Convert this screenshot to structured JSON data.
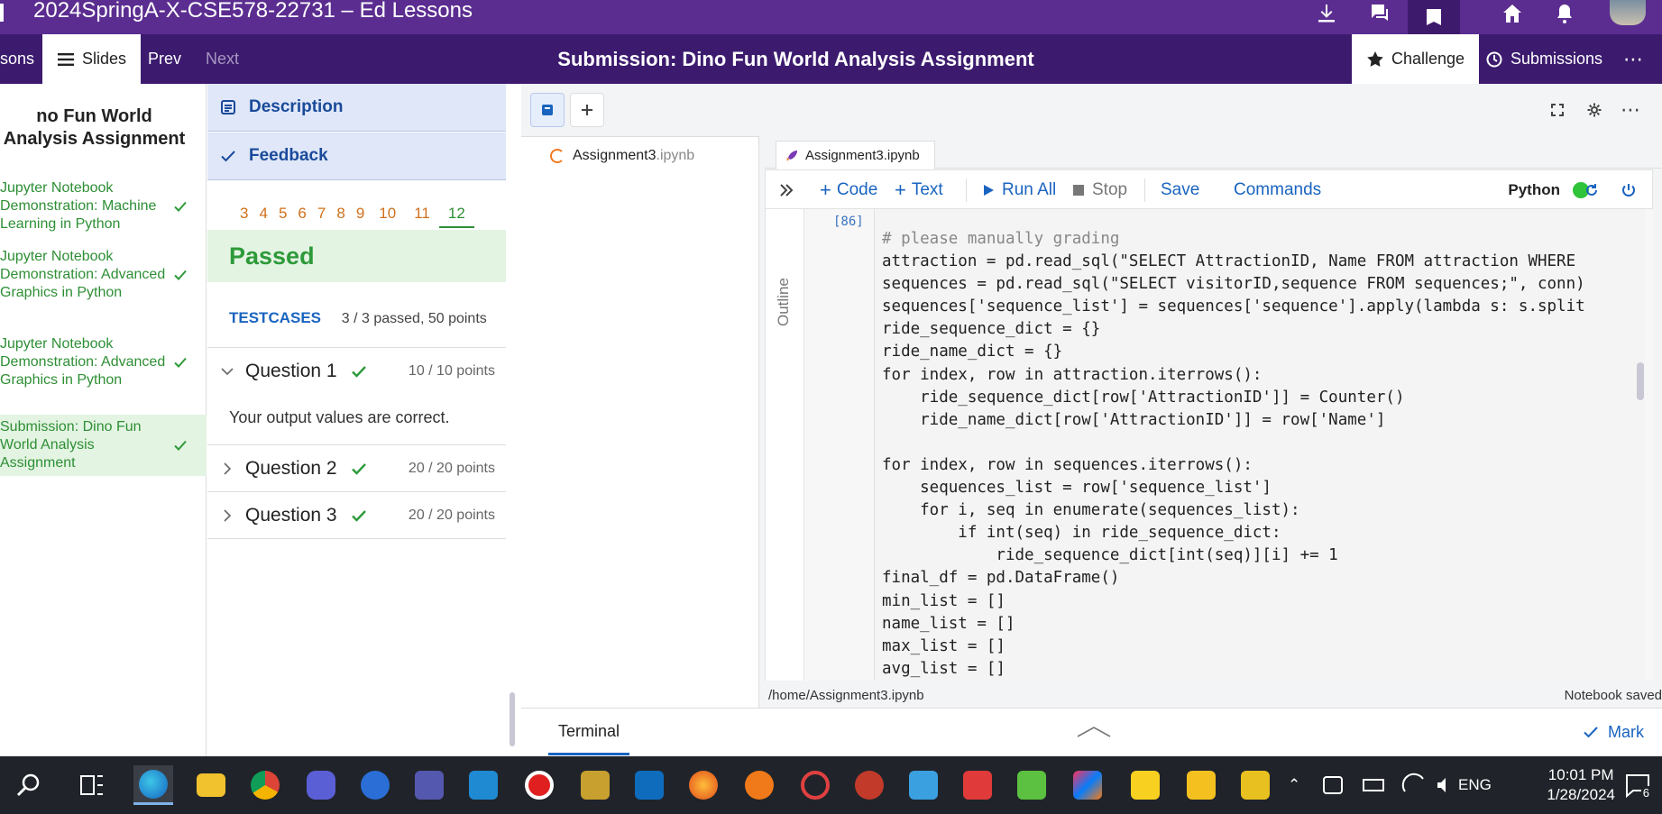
{
  "titlebar": {
    "title": "2024SpringA-X-CSE578-22731 – Ed Lessons",
    "icons": [
      "download-icon",
      "chat-icon",
      "book-icon",
      "home-icon",
      "bell-icon",
      "avatar"
    ]
  },
  "lessonbar": {
    "lessons_partial": "sons",
    "slides": "Slides",
    "prev": "Prev",
    "next": "Next",
    "title": "Submission: Dino Fun World Analysis Assignment",
    "challenge": "Challenge",
    "submissions": "Submissions",
    "more": "⋯"
  },
  "slidelist": {
    "lesson_title": "no Fun World Analysis Assignment",
    "items": [
      {
        "label": "Jupyter Notebook Demonstration: Machine Learning in Python",
        "done": true
      },
      {
        "label": "Jupyter Notebook Demonstration: Advanced Graphics in Python",
        "done": true
      },
      {
        "label": "Jupyter Notebook Demonstration: Advanced Graphics in Python",
        "done": true
      },
      {
        "label": "Submission: Dino Fun World Analysis Assignment",
        "done": true,
        "active": true
      }
    ]
  },
  "feedback": {
    "description": "Description",
    "feedback": "Feedback",
    "tabs": [
      "3",
      "4",
      "5",
      "6",
      "7",
      "8",
      "9",
      "10",
      "11",
      "12"
    ],
    "active_tab": "12",
    "status": "Passed",
    "testcases_label": "TESTCASES",
    "testcases_summary": "3 / 3 passed, 50 points",
    "questions": [
      {
        "title": "Question 1",
        "points": "10 / 10 points",
        "expanded": true,
        "message": "Your output values are correct."
      },
      {
        "title": "Question 2",
        "points": "20 / 20 points",
        "expanded": false
      },
      {
        "title": "Question 3",
        "points": "20 / 20 points",
        "expanded": false
      }
    ]
  },
  "notebook": {
    "file_name": "Assignment3",
    "file_ext": ".ipynb",
    "tab_label": "Assignment3.ipynb",
    "commands": {
      "code": "Code",
      "text": "Text",
      "run_all": "Run All",
      "stop": "Stop",
      "save": "Save",
      "commands": "Commands"
    },
    "kernel": "Python",
    "kernel_color": "#2fc43a",
    "outline": "Outline",
    "cell_number": "[86]",
    "status_path": "/home/Assignment3.ipynb",
    "status_saved": "Notebook saved",
    "terminal": "Terminal",
    "mark": "Mark",
    "code_lines": [
      "# please manually grading",
      "attraction = pd.read_sql(\"SELECT AttractionID, Name FROM attraction WHERE",
      "sequences = pd.read_sql(\"SELECT visitorID,sequence FROM sequences;\", conn)",
      "sequences['sequence_list'] = sequences['sequence'].apply(lambda s: s.split",
      "ride_sequence_dict = {}",
      "ride_name_dict = {}",
      "for index, row in attraction.iterrows():",
      "    ride_sequence_dict[row['AttractionID']] = Counter()",
      "    ride_name_dict[row['AttractionID']] = row['Name']",
      "",
      "for index, row in sequences.iterrows():",
      "    sequences_list = row['sequence_list']",
      "    for i, seq in enumerate(sequences_list):",
      "        if int(seq) in ride_sequence_dict:",
      "            ride_sequence_dict[int(seq)][i] += 1",
      "final_df = pd.DataFrame()",
      "min_list = []",
      "name_list = []",
      "max_list = []",
      "avg_list = []"
    ]
  },
  "taskbar": {
    "apps": [
      "search-icon",
      "task-view-icon",
      "edge-icon",
      "file-explorer-icon",
      "chrome-icon",
      "app-icon",
      "app-icon",
      "teams-icon",
      "vscode-icon",
      "record-icon",
      "app-icon",
      "outlook-icon",
      "firefox-icon",
      "app-icon",
      "app-icon",
      "app-icon",
      "app-icon",
      "app-icon",
      "intellij-icon",
      "sticky-notes-icon",
      "pdf-icon",
      "player-icon"
    ],
    "language": "ENG",
    "time": "10:01 PM",
    "date": "1/28/2024",
    "notifications": "6"
  }
}
